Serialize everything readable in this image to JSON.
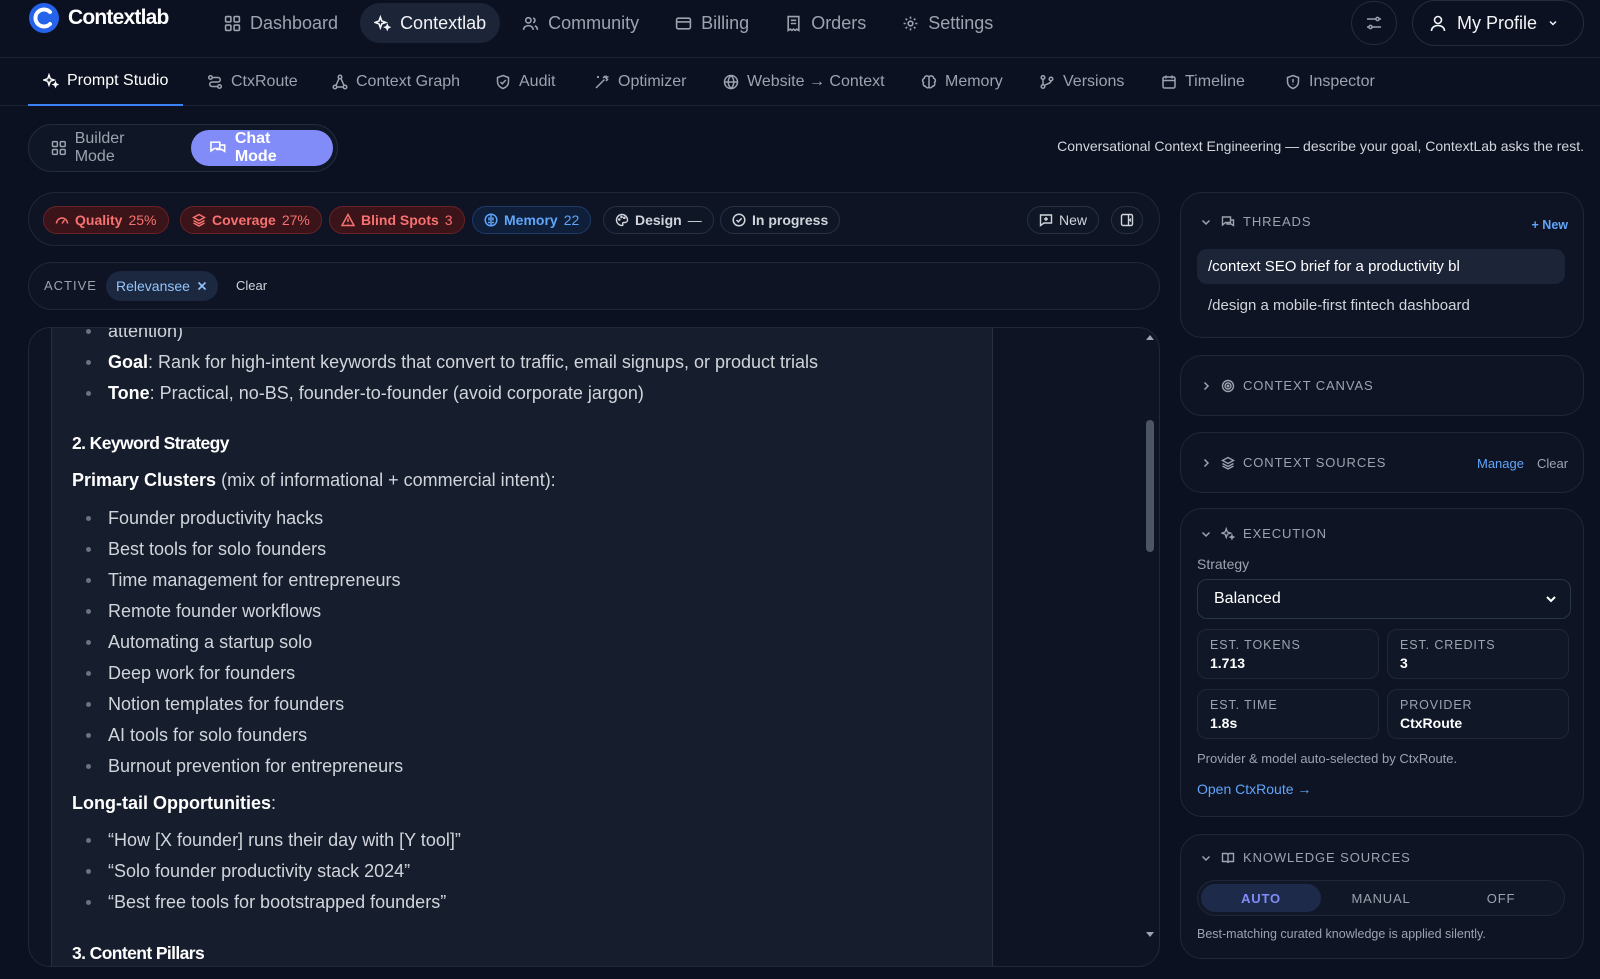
{
  "app": {
    "name": "Contextlab",
    "accent": "#818cf8",
    "link_color": "#60a5fa"
  },
  "nav": [
    {
      "label": "Dashboard",
      "icon": "grid-icon"
    },
    {
      "label": "Contextlab",
      "icon": "sparkle-icon",
      "active": true
    },
    {
      "label": "Community",
      "icon": "users-icon"
    },
    {
      "label": "Billing",
      "icon": "card-icon"
    },
    {
      "label": "Orders",
      "icon": "receipt-icon"
    },
    {
      "label": "Settings",
      "icon": "gear-icon"
    }
  ],
  "profile": {
    "label": "My Profile"
  },
  "tabs": [
    {
      "label": "Prompt Studio",
      "active": true
    },
    {
      "label": "CtxRoute"
    },
    {
      "label": "Context Graph"
    },
    {
      "label": "Audit"
    },
    {
      "label": "Optimizer"
    },
    {
      "label": "Website → Context"
    },
    {
      "label": "Memory"
    },
    {
      "label": "Versions"
    },
    {
      "label": "Timeline"
    },
    {
      "label": "Inspector"
    }
  ],
  "modes": {
    "builder": "Builder Mode",
    "chat": "Chat Mode",
    "active": "chat"
  },
  "tagline": "Conversational Context Engineering — describe your goal, ContextLab asks the rest.",
  "metrics": {
    "quality": {
      "label": "Quality",
      "value": "25%"
    },
    "coverage": {
      "label": "Coverage",
      "value": "27%"
    },
    "blind_spots": {
      "label": "Blind Spots",
      "value": "3"
    },
    "memory": {
      "label": "Memory",
      "value": "22"
    },
    "design": {
      "label": "Design",
      "value": "—"
    },
    "status": {
      "label": "In progress"
    },
    "new_label": "New"
  },
  "active_bar": {
    "label": "ACTIVE",
    "tag": "Relevansee",
    "clear": "Clear"
  },
  "message": {
    "cut_top": "attention)",
    "goal_label": "Goal",
    "goal_text": ": Rank for high-intent keywords that convert to traffic, email signups, or product trials",
    "tone_label": "Tone",
    "tone_text": ": Practical, no-BS, founder-to-founder (avoid corporate jargon)",
    "h_keyword": "2. Keyword Strategy",
    "primary_label": "Primary Clusters",
    "primary_text": " (mix of informational + commercial intent):",
    "clusters": [
      "Founder productivity hacks",
      "Best tools for solo founders",
      "Time management for entrepreneurs",
      "Remote founder workflows",
      "Automating a startup solo",
      "Deep work for founders",
      "Notion templates for founders",
      "AI tools for solo founders",
      "Burnout prevention for entrepreneurs"
    ],
    "longtail_label": "Long-tail Opportunities",
    "longtail_colon": ":",
    "longtail": [
      "“How [X founder] runs their day with [Y tool]”",
      "“Solo founder productivity stack 2024”",
      "“Best free tools for bootstrapped founders”"
    ],
    "h_pillars": "3. Content Pillars"
  },
  "threads": {
    "title": "THREADS",
    "new_label": "+ New",
    "items": [
      "/context SEO brief for a productivity bl",
      "/design a mobile-first fintech dashboard"
    ]
  },
  "context_canvas": {
    "title": "CONTEXT CANVAS"
  },
  "context_sources": {
    "title": "CONTEXT SOURCES",
    "manage": "Manage",
    "clear": "Clear"
  },
  "execution": {
    "title": "EXECUTION",
    "strategy_label": "Strategy",
    "strategy_value": "Balanced",
    "est_tokens_label": "EST. TOKENS",
    "est_tokens": "1.713",
    "est_credits_label": "EST. CREDITS",
    "est_credits": "3",
    "est_time_label": "EST. TIME",
    "est_time": "1.8s",
    "provider_label": "PROVIDER",
    "provider": "CtxRoute",
    "note": "Provider & model auto-selected by CtxRoute.",
    "open_link": "Open CtxRoute →"
  },
  "knowledge": {
    "title": "KNOWLEDGE SOURCES",
    "options": [
      "AUTO",
      "MANUAL",
      "OFF"
    ],
    "selected": "AUTO",
    "note": "Best-matching curated knowledge is applied silently."
  }
}
